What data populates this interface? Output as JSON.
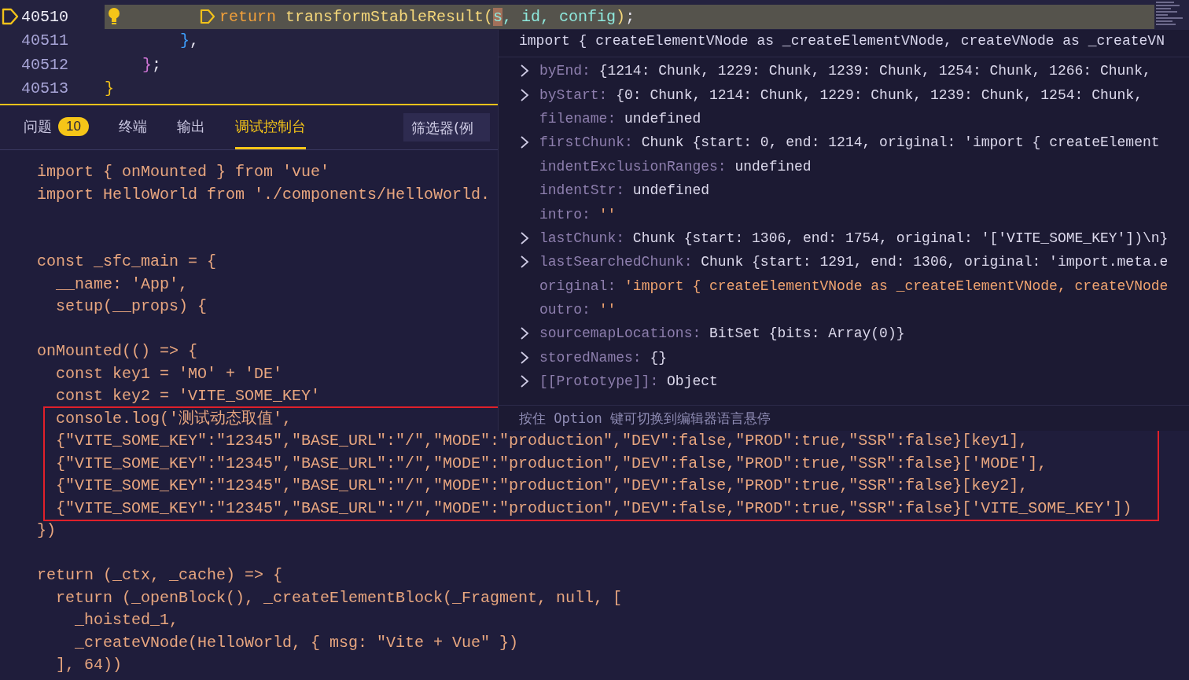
{
  "editor": {
    "lines": [
      {
        "number": "40510",
        "kind": "deep",
        "current": true,
        "breakpoint": true,
        "lightbulb": true,
        "tokens": [
          {
            "kind": "marker"
          },
          {
            "kind": "keyword",
            "text": "return"
          },
          {
            "kind": "function",
            "text": " transformStableResult("
          },
          {
            "kind": "cursor",
            "text": "s"
          },
          {
            "kind": "param",
            "text": ", id, config"
          },
          {
            "kind": "function",
            "text": ")"
          },
          {
            "kind": "plain",
            "text": ";"
          }
        ]
      },
      {
        "number": "40511",
        "kind": "medium",
        "current": false,
        "breakpoint": false,
        "lightbulb": false,
        "tokens": [
          {
            "kind": "brace_blue",
            "text": "}"
          },
          {
            "kind": "plain",
            "text": ","
          }
        ]
      },
      {
        "number": "40512",
        "kind": "shallow",
        "current": false,
        "breakpoint": false,
        "lightbulb": false,
        "tokens": [
          {
            "kind": "brace_pink",
            "text": "}"
          },
          {
            "kind": "plain",
            "text": ";"
          }
        ]
      },
      {
        "number": "40513",
        "kind": "flat",
        "current": false,
        "breakpoint": false,
        "lightbulb": false,
        "tokens": [
          {
            "kind": "brace_yellow",
            "text": "}"
          }
        ]
      }
    ]
  },
  "panel": {
    "tabs": [
      {
        "label": "问题",
        "badge": "10",
        "selected": false
      },
      {
        "label": "终端",
        "selected": false
      },
      {
        "label": "输出",
        "selected": false
      },
      {
        "label": "调试控制台",
        "selected": true
      }
    ],
    "filter": {
      "placeholder": "筛选器(例"
    },
    "console": [
      {
        "kind": "first",
        "lines": [
          "import { onMounted } from 'vue'",
          "import HelloWorld from './components/HelloWorld."
        ]
      },
      {
        "kind": "after_double_gap",
        "lines": [
          "const _sfc_main = {",
          "  __name: 'App',",
          "  setup(__props) {"
        ]
      },
      {
        "kind": "after_gap",
        "lines": [
          "onMounted(() => {",
          "  const key1 = 'MO' + 'DE'",
          "  const key2 = 'VITE_SOME_KEY'",
          "  console.log('测试动态取值',",
          "  {\"VITE_SOME_KEY\":\"12345\",\"BASE_URL\":\"/\",\"MODE\":\"production\",\"DEV\":false,\"PROD\":true,\"SSR\":false}[key1],",
          "  {\"VITE_SOME_KEY\":\"12345\",\"BASE_URL\":\"/\",\"MODE\":\"production\",\"DEV\":false,\"PROD\":true,\"SSR\":false}['MODE'],",
          "  {\"VITE_SOME_KEY\":\"12345\",\"BASE_URL\":\"/\",\"MODE\":\"production\",\"DEV\":false,\"PROD\":true,\"SSR\":false}[key2],",
          "  {\"VITE_SOME_KEY\":\"12345\",\"BASE_URL\":\"/\",\"MODE\":\"production\",\"DEV\":false,\"PROD\":true,\"SSR\":false}['VITE_SOME_KEY'])",
          "})"
        ]
      },
      {
        "kind": "after_gap",
        "lines": [
          "return (_ctx, _cache) => {",
          "  return (_openBlock(), _createElementBlock(_Fragment, null, [",
          "    _hoisted_1,",
          "    _createVNode(HelloWorld, { msg: \"Vite + Vue\" })",
          "  ], 64))"
        ]
      }
    ]
  },
  "hover": {
    "header": "import { createElementVNode as _createElementVNode, createVNode as _createVN",
    "properties": [
      {
        "name": "byEnd:",
        "value": "{1214: Chunk, 1229: Chunk, 1239: Chunk, 1254: Chunk, 1266: Chunk,",
        "expandable": true,
        "kind": "plain"
      },
      {
        "name": "byStart:",
        "value": "{0: Chunk, 1214: Chunk, 1229: Chunk, 1239: Chunk, 1254: Chunk,",
        "expandable": true,
        "kind": "plain"
      },
      {
        "name": "filename:",
        "value": "undefined",
        "expandable": false,
        "kind": "plain"
      },
      {
        "name": "firstChunk:",
        "value": "Chunk {start: 0, end: 1214, original: 'import { createElement",
        "expandable": true,
        "kind": "plain"
      },
      {
        "name": "indentExclusionRanges:",
        "value": "undefined",
        "expandable": false,
        "kind": "plain"
      },
      {
        "name": "indentStr:",
        "value": "undefined",
        "expandable": false,
        "kind": "plain"
      },
      {
        "name": "intro:",
        "value": "''",
        "expandable": false,
        "kind": "string"
      },
      {
        "name": "lastChunk:",
        "value": "Chunk {start: 1306, end: 1754, original: '['VITE_SOME_KEY'])\\n}",
        "expandable": true,
        "kind": "plain"
      },
      {
        "name": "lastSearchedChunk:",
        "value": "Chunk {start: 1291, end: 1306, original: 'import.meta.e",
        "expandable": true,
        "kind": "plain"
      },
      {
        "name": "original:",
        "value": "'import { createElementVNode as _createElementVNode, createVNode",
        "expandable": false,
        "kind": "string"
      },
      {
        "name": "outro:",
        "value": "''",
        "expandable": false,
        "kind": "string"
      },
      {
        "name": "sourcemapLocations:",
        "value": "BitSet {bits: Array(0)}",
        "expandable": true,
        "kind": "plain"
      },
      {
        "name": "storedNames:",
        "value": "{}",
        "expandable": true,
        "kind": "plain"
      },
      {
        "name": "[[Prototype]]:",
        "value": "Object",
        "expandable": true,
        "kind": "plain"
      }
    ],
    "hint": "按住 Option 键可切换到编辑器语言悬停"
  }
}
